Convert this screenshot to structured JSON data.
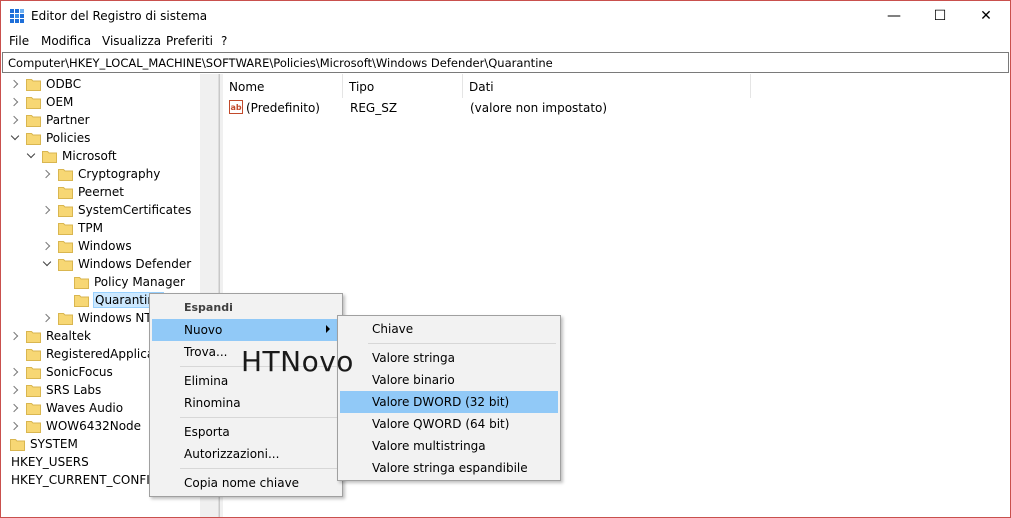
{
  "window": {
    "title": "Editor del Registro di sistema",
    "controls": {
      "minimize": "—",
      "maximize": "☐",
      "close": "✕"
    }
  },
  "menubar": {
    "items": [
      "File",
      "Modifica",
      "Visualizza",
      "Preferiti",
      "?"
    ]
  },
  "address": {
    "path": "Computer\\HKEY_LOCAL_MACHINE\\SOFTWARE\\Policies\\Microsoft\\Windows Defender\\Quarantine"
  },
  "tree": {
    "items": [
      {
        "label": "ODBC",
        "expander": "right",
        "selected": false
      },
      {
        "label": "OEM",
        "expander": "right",
        "selected": false
      },
      {
        "label": "Partner",
        "expander": "right",
        "selected": false
      },
      {
        "label": "Policies",
        "expander": "down",
        "selected": false
      },
      {
        "label": "Microsoft",
        "expander": "down",
        "selected": false
      },
      {
        "label": "Cryptography",
        "expander": "right",
        "selected": false
      },
      {
        "label": "Peernet",
        "expander": "none",
        "selected": false
      },
      {
        "label": "SystemCertificates",
        "expander": "right",
        "selected": false
      },
      {
        "label": "TPM",
        "expander": "none",
        "selected": false
      },
      {
        "label": "Windows",
        "expander": "right",
        "selected": false
      },
      {
        "label": "Windows Defender",
        "expander": "down",
        "selected": false
      },
      {
        "label": "Policy Manager",
        "expander": "none",
        "selected": false
      },
      {
        "label": "Quarantine",
        "expander": "none",
        "selected": true
      },
      {
        "label": "Windows NT",
        "expander": "right",
        "selected": false
      },
      {
        "label": "Realtek",
        "expander": "right",
        "selected": false
      },
      {
        "label": "RegisteredApplications",
        "expander": "none",
        "selected": false
      },
      {
        "label": "SonicFocus",
        "expander": "right",
        "selected": false
      },
      {
        "label": "SRS Labs",
        "expander": "right",
        "selected": false
      },
      {
        "label": "Waves Audio",
        "expander": "right",
        "selected": false
      },
      {
        "label": "WOW6432Node",
        "expander": "right",
        "selected": false
      },
      {
        "label": "SYSTEM",
        "expander": "none",
        "selected": false
      },
      {
        "label": "HKEY_USERS",
        "expander": "none",
        "selected": false
      },
      {
        "label": "HKEY_CURRENT_CONFIG",
        "expander": "none",
        "selected": false
      }
    ]
  },
  "list": {
    "columns": [
      "Nome",
      "Tipo",
      "Dati"
    ],
    "rows": [
      {
        "name": "(Predefinito)",
        "type": "REG_SZ",
        "data": "(valore non impostato)",
        "icon": "string-value-icon"
      }
    ]
  },
  "context_menu": {
    "items": [
      "Espandi",
      "Nuovo",
      "Trova...",
      "Elimina",
      "Rinomina",
      "Esporta",
      "Autorizzazioni...",
      "Copia nome chiave"
    ]
  },
  "submenu": {
    "items": [
      "Chiave",
      "Valore stringa",
      "Valore binario",
      "Valore DWORD (32 bit)",
      "Valore QWORD (64 bit)",
      "Valore multistringa",
      "Valore stringa espandibile"
    ]
  },
  "watermark": "HTNovo",
  "colors": {
    "highlight": "#91c9f7",
    "selection": "#cce8ff",
    "folder": "#f7d774",
    "window_border": "#c9504d"
  }
}
